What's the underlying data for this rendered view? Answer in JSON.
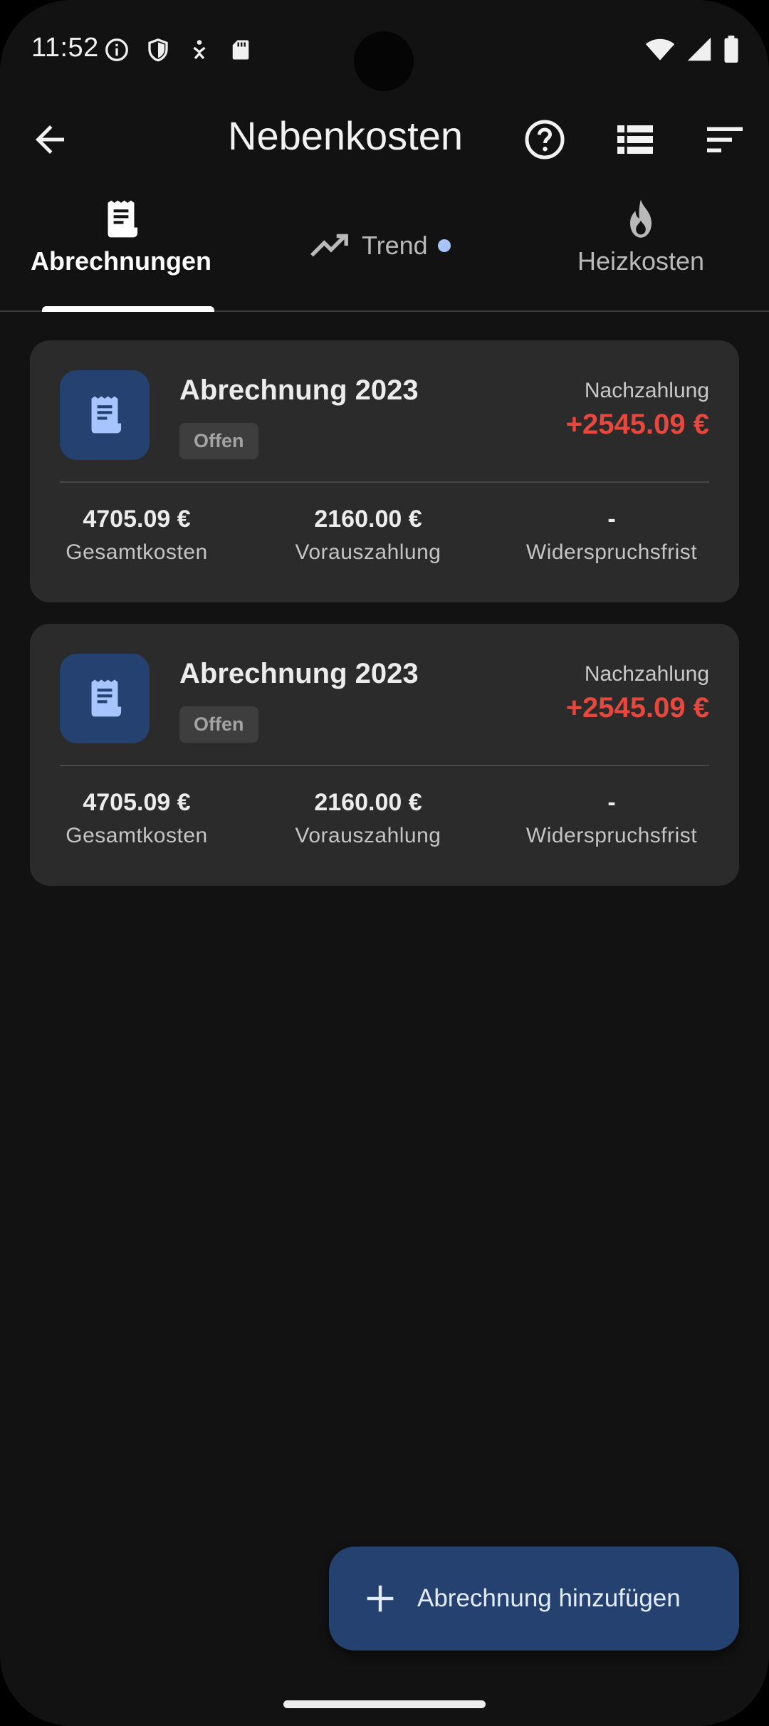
{
  "status_bar": {
    "time": "11:52"
  },
  "app_bar": {
    "title": "Nebenkosten"
  },
  "tabs": [
    {
      "label": "Abrechnungen",
      "selected": true,
      "icon": "receipt-icon"
    },
    {
      "label": "Trend",
      "selected": false,
      "icon": "trending-up-icon",
      "has_dot": true
    },
    {
      "label": "Heizkosten",
      "selected": false,
      "icon": "flame-icon"
    }
  ],
  "cards": [
    {
      "title": "Abrechnung 2023",
      "status": "Offen",
      "result_label": "Nachzahlung",
      "result_amount": "+2545.09 €",
      "stats": [
        {
          "value": "4705.09 €",
          "label": "Gesamtkosten"
        },
        {
          "value": "2160.00 €",
          "label": "Vorauszahlung"
        },
        {
          "value": "-",
          "label": "Widerspruchsfrist"
        }
      ]
    },
    {
      "title": "Abrechnung 2023",
      "status": "Offen",
      "result_label": "Nachzahlung",
      "result_amount": "+2545.09 €",
      "stats": [
        {
          "value": "4705.09 €",
          "label": "Gesamtkosten"
        },
        {
          "value": "2160.00 €",
          "label": "Vorauszahlung"
        },
        {
          "value": "-",
          "label": "Widerspruchsfrist"
        }
      ]
    }
  ],
  "fab": {
    "label": "Abrechnung hinzufügen"
  },
  "colors": {
    "background": "#121212",
    "card": "#2b2b2b",
    "accent_container": "#25416f",
    "negative_amount": "#e8473d"
  }
}
